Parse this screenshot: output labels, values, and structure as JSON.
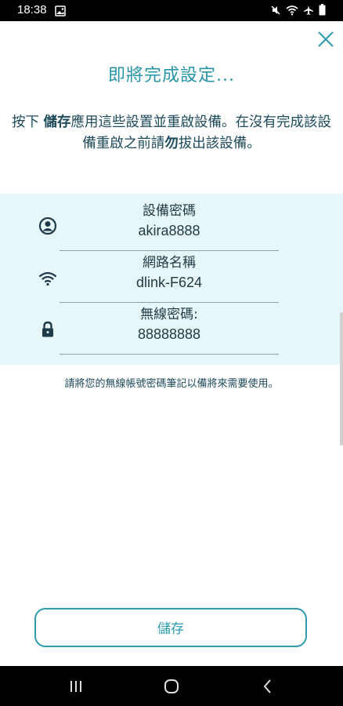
{
  "status_bar": {
    "time": "18:38",
    "left_icons": [
      "image-icon"
    ],
    "right_icons": [
      "mute-icon",
      "wifi-icon",
      "airplane-icon",
      "battery-icon"
    ]
  },
  "header": {
    "close_icon": "close-icon",
    "title": "即將完成設定..."
  },
  "instruction": {
    "part1": "按下 ",
    "save_bold": "儲存",
    "part2": "應用這些設置並重啟設備。在沒有完成該設備重啟之前請",
    "dont_bold": "勿",
    "part3": "拔出該設備。"
  },
  "info": {
    "rows": [
      {
        "icon": "user-icon",
        "label": "設備密碼",
        "value": "akira8888"
      },
      {
        "icon": "wifi-icon",
        "label": "網路名稱",
        "value": "dlink-F624"
      },
      {
        "icon": "lock-icon",
        "label": "無線密碼:",
        "value": "88888888"
      }
    ]
  },
  "note": "請將您的無線帳號密碼筆記以備將來需要使用。",
  "save_button": {
    "label": "儲存"
  },
  "colors": {
    "accent": "#2c9cae",
    "panel_bg": "#e6f6f9",
    "text_dark": "#1d4a5a"
  },
  "nav_bar": {
    "icons": [
      "recents-icon",
      "home-icon",
      "back-icon"
    ]
  }
}
